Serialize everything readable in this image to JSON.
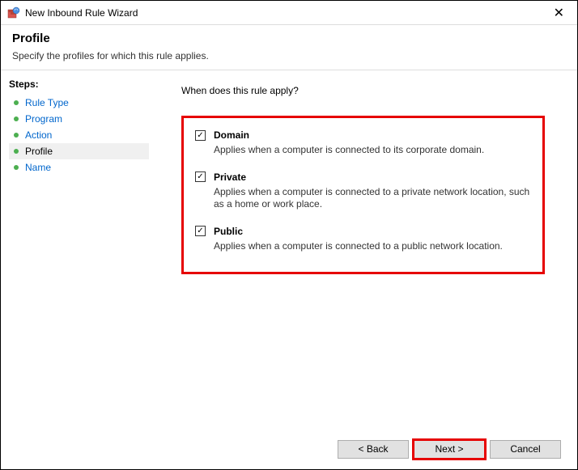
{
  "titlebar": {
    "title": "New Inbound Rule Wizard"
  },
  "header": {
    "title": "Profile",
    "subtitle": "Specify the profiles for which this rule applies."
  },
  "sidebar": {
    "title": "Steps:",
    "items": [
      {
        "label": "Rule Type"
      },
      {
        "label": "Program"
      },
      {
        "label": "Action"
      },
      {
        "label": "Profile"
      },
      {
        "label": "Name"
      }
    ]
  },
  "main": {
    "question": "When does this rule apply?",
    "options": [
      {
        "label": "Domain",
        "desc": "Applies when a computer is connected to its corporate domain.",
        "checked": true
      },
      {
        "label": "Private",
        "desc": "Applies when a computer is connected to a private network location, such as a home or work place.",
        "checked": true
      },
      {
        "label": "Public",
        "desc": "Applies when a computer is connected to a public network location.",
        "checked": true
      }
    ]
  },
  "footer": {
    "back": "< Back",
    "next": "Next >",
    "cancel": "Cancel"
  }
}
